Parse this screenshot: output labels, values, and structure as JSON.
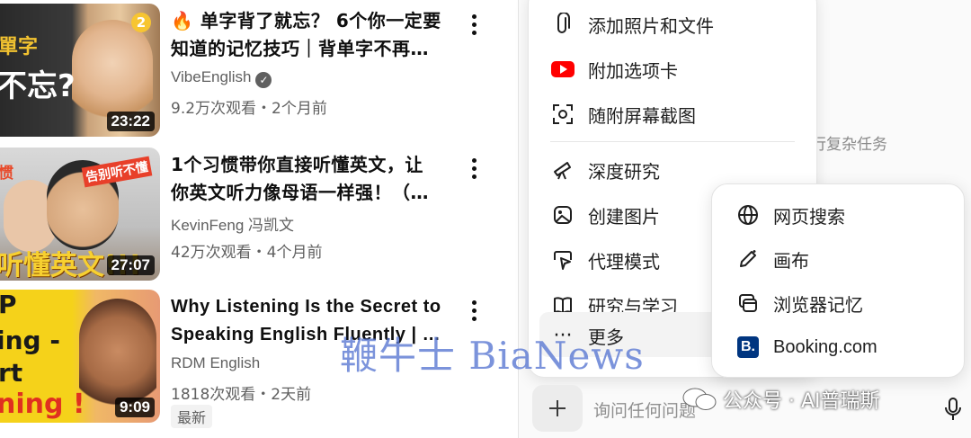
{
  "videos": [
    {
      "title_line1": "🔥 单字背了就忘？ 6个你一定要",
      "title_line2": "知道的记忆技巧｜背单字不再…",
      "channel": "VibeEnglish",
      "verified": true,
      "meta": "9.2万次观看・2个月前",
      "duration": "23:22",
      "badge": "2",
      "thumb_text": [
        "單字",
        "不忘?"
      ],
      "new_tag": ""
    },
    {
      "title_line1": "1个习惯带你直接听懂英文，让",
      "title_line2": "你英文听力像母语一样强！（…",
      "channel": "KevinFeng 冯凯文",
      "verified": false,
      "meta": "42万次观看・4个月前",
      "duration": "27:07",
      "thumb_text": [
        "惯",
        "告别听不懂",
        "听懂英文!!!"
      ],
      "new_tag": ""
    },
    {
      "title_line1": "Why Listening Is the Secret to",
      "title_line2": "Speaking English Fluently | …",
      "channel": "RDM English",
      "verified": false,
      "meta": "1818次观看・2天前",
      "duration": "9:09",
      "thumb_text": [
        "P",
        "ing -",
        "rt",
        "ning !"
      ],
      "new_tag": "最新"
    }
  ],
  "menu": {
    "items_group1": [
      {
        "label": "添加照片和文件",
        "icon": "paperclip-icon"
      },
      {
        "label": "附加选项卡",
        "icon": "youtube-icon"
      },
      {
        "label": "随附屏幕截图",
        "icon": "screenshot-icon"
      }
    ],
    "items_group2": [
      {
        "label": "深度研究",
        "icon": "telescope-icon"
      },
      {
        "label": "创建图片",
        "icon": "image-icon"
      },
      {
        "label": "代理模式",
        "icon": "agent-cursor-icon"
      },
      {
        "label": "研究与学习",
        "icon": "book-icon"
      },
      {
        "label": "更多",
        "icon": "ellipsis-icon"
      }
    ]
  },
  "submenu": {
    "items": [
      {
        "label": "网页搜索",
        "icon": "globe-icon"
      },
      {
        "label": "画布",
        "icon": "pen-icon"
      },
      {
        "label": "浏览器记忆",
        "icon": "browser-memory-icon"
      },
      {
        "label": "Booking.com",
        "icon": "booking-logo-icon",
        "logo_letter": "B."
      }
    ]
  },
  "hint_text": "行复杂任务",
  "composer": {
    "placeholder": "询问任何问题"
  },
  "wechat_caption": "公众号 · AI普瑞斯",
  "watermark": "鞭牛士 BiaNews",
  "colors": {
    "youtube_red": "#ff0000",
    "booking_blue": "#003580",
    "watermark_blue": "#5a78d2"
  }
}
